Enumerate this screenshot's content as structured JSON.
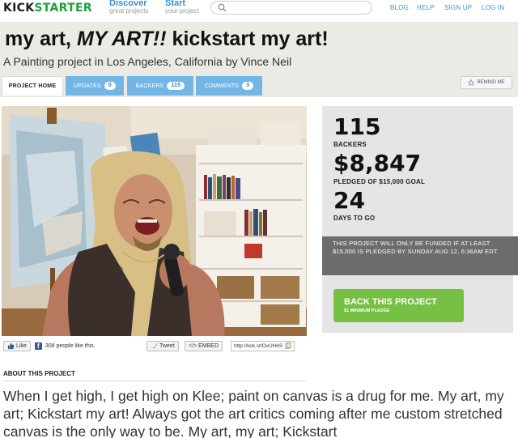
{
  "nav": {
    "logo_kick": "KICK",
    "logo_starter": "STARTER",
    "discover": {
      "label": "Discover",
      "sub": "great projects"
    },
    "start": {
      "label": "Start",
      "sub": "your project"
    },
    "links": [
      "BLOG",
      "HELP",
      "SIGN UP",
      "LOG IN"
    ]
  },
  "project": {
    "title_pre": "my art, ",
    "title_em": "MY ART!!",
    "title_post": " kickstart my art!",
    "subtitle": "A Painting project in Los Angeles, California by Vince Neil"
  },
  "tabs": {
    "home": "PROJECT HOME",
    "updates": {
      "label": "UPDATES",
      "count": "0"
    },
    "backers": {
      "label": "BACKERS",
      "count": "115"
    },
    "comments": {
      "label": "COMMENTS",
      "count": "3"
    },
    "remind": "REMIND ME"
  },
  "stats": {
    "backers_num": "115",
    "backers_label": "BACKERS",
    "pledged_num": "$8,847",
    "pledged_label": "PLEDGED OF $15,000 GOAL",
    "days_num": "24",
    "days_label": "DAYS TO GO",
    "fund_note": "THIS PROJECT WILL ONLY BE FUNDED IF AT LEAST $15,000 IS PLEDGED BY SUNDAY AUG 12, 6:36AM EDT.",
    "back_button": "BACK THIS PROJECT",
    "min_pledge": "$1 MINIMUM PLEDGE"
  },
  "social": {
    "like": "Like",
    "like_count": "308 people like this.",
    "tweet": "Tweet",
    "embed": "EMBED",
    "short_url": "http://kck.st/OxUH6S"
  },
  "about": {
    "heading": "ABOUT THIS PROJECT",
    "text": "When I get high, I get high on Klee; paint on canvas is a drug for me. My art, my art; Kickstart my art! Always got the art critics coming after me custom stretched canvas is the only way to be. My art, my art; Kickstart"
  },
  "colors": {
    "brand_green": "#1ea03a",
    "link_blue": "#3a8fd8",
    "tab_blue": "#73b6e6",
    "back_green": "#76c043",
    "note_gray": "#6c6c6c"
  },
  "icons": [
    "search-icon",
    "star-icon",
    "facebook-like-icon",
    "facebook-icon",
    "twitter-icon",
    "embed-icon",
    "copy-icon"
  ]
}
